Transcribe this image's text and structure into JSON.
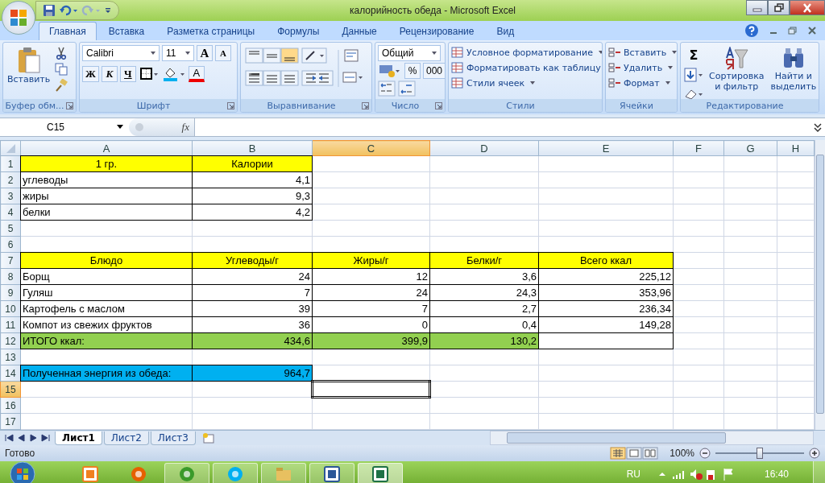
{
  "window": {
    "title": "калорийность обеда - Microsoft Excel"
  },
  "tabs": [
    {
      "label": "Главная",
      "selected": true
    },
    {
      "label": "Вставка",
      "selected": false
    },
    {
      "label": "Разметка страницы",
      "selected": false
    },
    {
      "label": "Формулы",
      "selected": false
    },
    {
      "label": "Данные",
      "selected": false
    },
    {
      "label": "Рецензирование",
      "selected": false
    },
    {
      "label": "Вид",
      "selected": false
    }
  ],
  "ribbon": [
    {
      "kind": "clipboard",
      "label": "Буфер обм...",
      "paste": "Вставить"
    },
    {
      "kind": "font",
      "label": "Шрифт",
      "font_name": "Calibri",
      "font_size": "11",
      "grow": "A",
      "shrink": "A",
      "bold": "Ж",
      "italic": "К",
      "underline": "Ч",
      "font_color": "A"
    },
    {
      "kind": "alignment",
      "label": "Выравнивание"
    },
    {
      "kind": "number",
      "label": "Число",
      "format": "Общий",
      "percent": "%",
      "thousands": "000"
    },
    {
      "kind": "styles",
      "label": "Стили",
      "items": [
        "Условное форматирование",
        "Форматировать как таблицу",
        "Стили ячеек"
      ]
    },
    {
      "kind": "cells",
      "label": "Ячейки",
      "items": [
        "Вставить",
        "Удалить",
        "Формат"
      ]
    },
    {
      "kind": "editing",
      "label": "Редактирование",
      "sum": "Σ",
      "sort": "Сортировка",
      "sort2": "и фильтр",
      "find": "Найти и",
      "find2": "выделить"
    }
  ],
  "formula_bar": {
    "name_box": "C15",
    "fx": "fx"
  },
  "columns": [
    {
      "label": "A",
      "selected": false
    },
    {
      "label": "B",
      "selected": false
    },
    {
      "label": "C",
      "selected": true
    },
    {
      "label": "D",
      "selected": false
    },
    {
      "label": "E",
      "selected": false
    },
    {
      "label": "F",
      "selected": false
    },
    {
      "label": "G",
      "selected": false
    },
    {
      "label": "H",
      "selected": false
    }
  ],
  "rows": [
    {
      "number": "1",
      "selected": false,
      "cells": [
        {
          "text": "1 гр.",
          "kind": "heading",
          "color": "#ffff00",
          "bordered": true
        },
        {
          "text": "Калории",
          "kind": "heading",
          "color": "#ffff00",
          "bordered": true
        }
      ]
    },
    {
      "number": "2",
      "selected": false,
      "cells": [
        {
          "text": "углеводы",
          "kind": "label",
          "bordered": true
        },
        {
          "text": "4,1",
          "kind": "number",
          "bordered": true
        }
      ]
    },
    {
      "number": "3",
      "selected": false,
      "cells": [
        {
          "text": "жиры",
          "kind": "label",
          "bordered": true
        },
        {
          "text": "9,3",
          "kind": "number",
          "bordered": true
        }
      ]
    },
    {
      "number": "4",
      "selected": false,
      "cells": [
        {
          "text": "белки",
          "kind": "label",
          "bordered": true
        },
        {
          "text": "4,2",
          "kind": "number",
          "bordered": true
        }
      ]
    },
    {
      "number": "5",
      "selected": false
    },
    {
      "number": "6",
      "selected": false
    },
    {
      "number": "7",
      "selected": false,
      "cells": [
        {
          "text": "Блюдо",
          "kind": "heading",
          "color": "#ffff00",
          "bordered": true
        },
        {
          "text": "Углеводы/г",
          "kind": "heading",
          "color": "#ffff00",
          "bordered": true
        },
        {
          "text": "Жиры/г",
          "kind": "heading",
          "color": "#ffff00",
          "bordered": true
        },
        {
          "text": "Белки/г",
          "kind": "heading",
          "color": "#ffff00",
          "bordered": true
        },
        {
          "text": "Всего ккал",
          "kind": "heading",
          "color": "#ffff00",
          "bordered": true
        }
      ]
    },
    {
      "number": "8",
      "selected": false,
      "cells": [
        {
          "text": "Борщ",
          "kind": "label",
          "bordered": true
        },
        {
          "text": "24",
          "kind": "number",
          "bordered": true
        },
        {
          "text": "12",
          "kind": "number",
          "bordered": true
        },
        {
          "text": "3,6",
          "kind": "number",
          "bordered": true
        },
        {
          "text": "225,12",
          "kind": "number",
          "bordered": true
        }
      ]
    },
    {
      "number": "9",
      "selected": false,
      "cells": [
        {
          "text": "Гуляш",
          "kind": "label",
          "bordered": true
        },
        {
          "text": "7",
          "kind": "number",
          "bordered": true
        },
        {
          "text": "24",
          "kind": "number",
          "bordered": true
        },
        {
          "text": "24,3",
          "kind": "number",
          "bordered": true
        },
        {
          "text": "353,96",
          "kind": "number",
          "bordered": true
        }
      ]
    },
    {
      "number": "10",
      "selected": false,
      "cells": [
        {
          "text": "Картофель с маслом",
          "kind": "label",
          "bordered": true
        },
        {
          "text": "39",
          "kind": "number",
          "bordered": true
        },
        {
          "text": "7",
          "kind": "number",
          "bordered": true
        },
        {
          "text": "2,7",
          "kind": "number",
          "bordered": true
        },
        {
          "text": "236,34",
          "kind": "number",
          "bordered": true
        }
      ]
    },
    {
      "number": "11",
      "selected": false,
      "cells": [
        {
          "text": "Компот из свежих фруктов",
          "kind": "label",
          "bordered": true
        },
        {
          "text": "36",
          "kind": "number",
          "bordered": true
        },
        {
          "text": "0",
          "kind": "number",
          "bordered": true
        },
        {
          "text": "0,4",
          "kind": "number",
          "bordered": true
        },
        {
          "text": "149,28",
          "kind": "number",
          "bordered": true
        }
      ]
    },
    {
      "number": "12",
      "selected": false,
      "cells": [
        {
          "text": "ИТОГО ккал:",
          "kind": "label",
          "color": "#92d050",
          "bordered": true
        },
        {
          "text": "434,6",
          "kind": "number",
          "color": "#92d050",
          "bordered": true
        },
        {
          "text": "399,9",
          "kind": "number",
          "color": "#92d050",
          "bordered": true
        },
        {
          "text": "130,2",
          "kind": "number",
          "color": "#92d050",
          "bordered": true
        },
        {
          "bordered": true
        }
      ]
    },
    {
      "number": "13",
      "selected": false
    },
    {
      "number": "14",
      "selected": false,
      "cells": [
        {
          "text": "Полученная энергия из обеда:",
          "kind": "label",
          "color": "#00b0f0",
          "bordered": true
        },
        {
          "text": "964,7",
          "kind": "number",
          "color": "#00b0f0",
          "bordered": true
        }
      ]
    },
    {
      "number": "15",
      "selected": true
    },
    {
      "number": "16",
      "selected": false
    },
    {
      "number": "17",
      "selected": false
    }
  ],
  "sheets": [
    {
      "label": "Лист1",
      "selected": true
    },
    {
      "label": "Лист2",
      "selected": false
    },
    {
      "label": "Лист3",
      "selected": false
    }
  ],
  "status_bar": {
    "text": "Готово",
    "zoom": "100%",
    "level": 0.5
  },
  "taskbar": {
    "apps": [
      {
        "kind": "media",
        "running": false,
        "selected": false
      },
      {
        "kind": "firefox",
        "running": false,
        "selected": false
      },
      {
        "kind": "torrent",
        "running": true,
        "selected": false
      },
      {
        "kind": "skype",
        "running": true,
        "selected": false
      },
      {
        "kind": "folder",
        "running": true,
        "selected": false
      },
      {
        "kind": "word",
        "running": true,
        "selected": false
      },
      {
        "kind": "excel",
        "running": true,
        "selected": true
      }
    ],
    "language": "RU",
    "time": "16:40"
  }
}
